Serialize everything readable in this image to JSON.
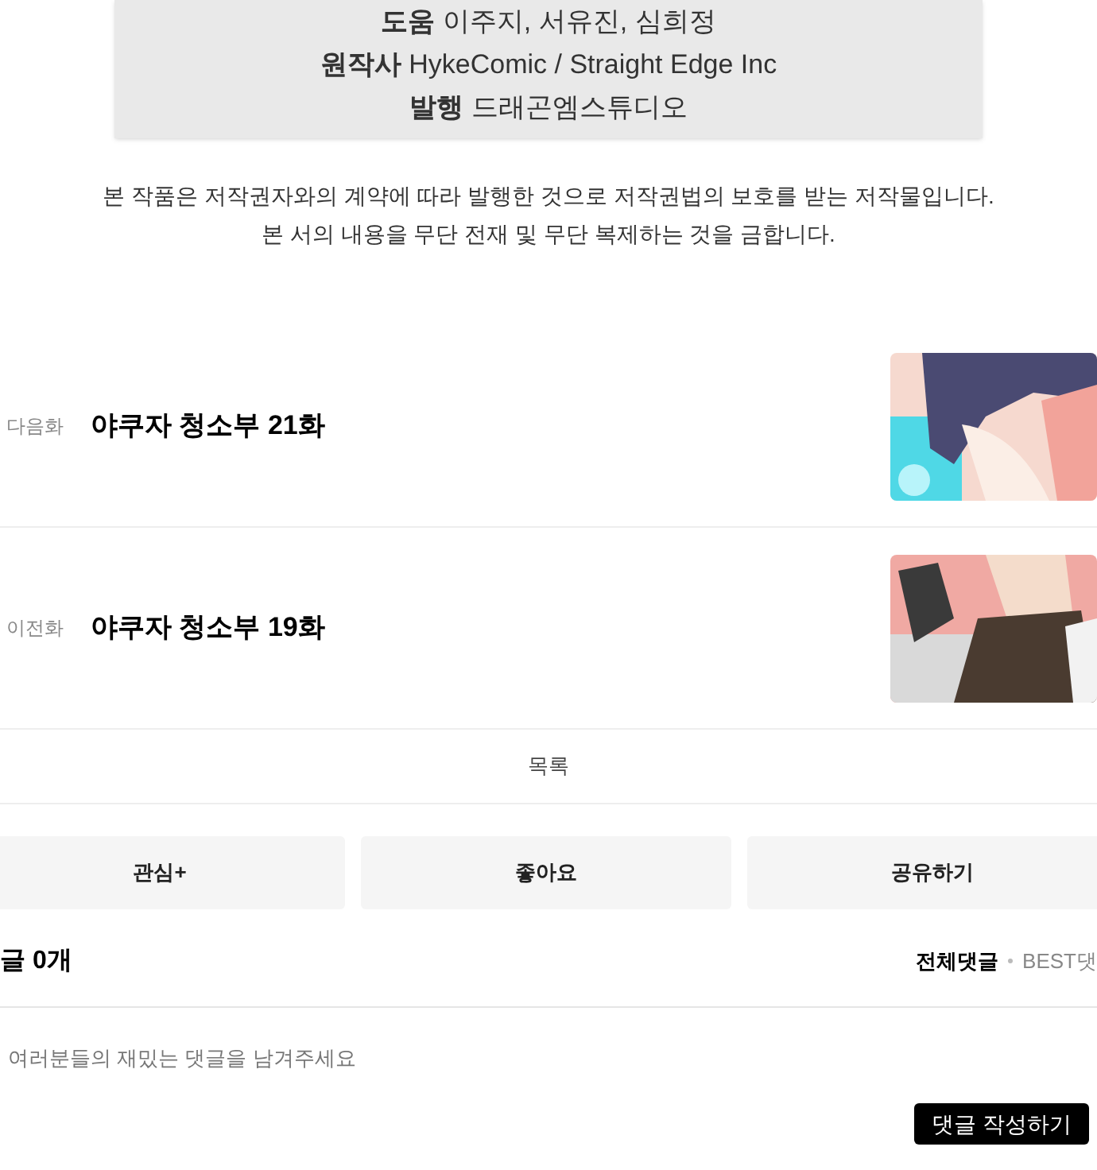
{
  "credits": [
    {
      "role": "도움",
      "value": "이주지, 서유진, 심희정"
    },
    {
      "role": "원작사",
      "value": "HykeComic / Straight Edge Inc"
    },
    {
      "role": "발행",
      "value": "드래곤엠스튜디오"
    }
  ],
  "notice": [
    "본 작품은 저작권자와의 계약에 따라 발행한 것으로 저작권법의 보호를 받는 저작물입니다.",
    "본 서의 내용을 무단 전재 및 무단 복제하는 것을 금합니다."
  ],
  "episodes": [
    {
      "label": "다음화",
      "title": "야쿠자 청소부 21화"
    },
    {
      "label": "이전화",
      "title": "야쿠자 청소부 19화"
    }
  ],
  "list_button": "목록",
  "actions": [
    "관심+",
    "좋아요",
    "공유하기"
  ],
  "comments": {
    "count": "글 0개",
    "tabs": [
      {
        "label": "전체댓글",
        "selected": true
      },
      {
        "label": "BEST댓",
        "selected": false
      }
    ],
    "placeholder": "여러분들의 재밌는 댓글을 남겨주세요",
    "submit": "댓글 작성하기"
  }
}
